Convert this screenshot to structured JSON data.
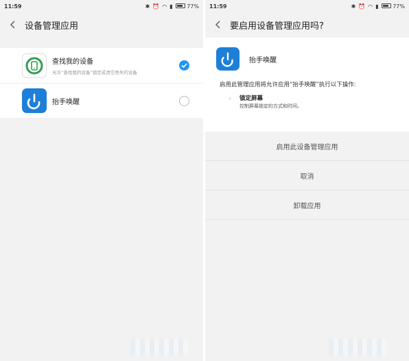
{
  "left": {
    "status": {
      "time": "11:59",
      "battery": "77%",
      "battery_level": 0.77
    },
    "title": "设备管理应用",
    "apps": [
      {
        "name": "查找我的设备",
        "desc": "允许“查找我的设备”锁定或清空丢失的设备",
        "checked": true,
        "icon": "find-device-icon"
      },
      {
        "name": "抬手唤醒",
        "desc": "",
        "checked": false,
        "icon": "raise-wake-icon"
      }
    ]
  },
  "right": {
    "status": {
      "time": "11:59",
      "battery": "77%",
      "battery_level": 0.77
    },
    "title": "要启用设备管理应用吗?",
    "app_name": "抬手唤醒",
    "message": "启用此管理应用将允许应用“抬手唤醒”执行以下操作:",
    "permission": {
      "title": "锁定屏幕",
      "desc": "控制屏幕锁定的方式和时间。"
    },
    "actions": [
      "启用此设备管理应用",
      "取消",
      "卸载应用"
    ]
  },
  "colors": {
    "accent": "#2196f3",
    "background": "#f2f2f2",
    "find_device_green": "#2e9e4f"
  }
}
